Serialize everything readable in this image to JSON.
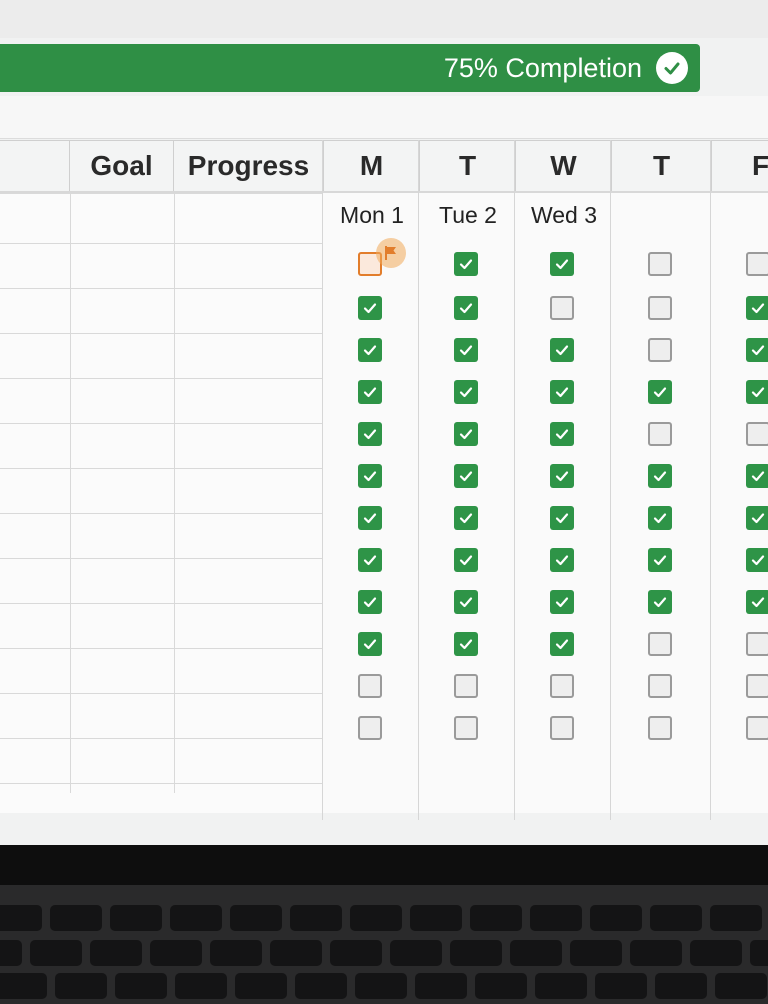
{
  "banner": {
    "completion_text": "75% Completion",
    "icon": "check-circle-icon"
  },
  "columns": {
    "goal": "Goal",
    "progress": "Progress"
  },
  "days": [
    {
      "letter": "M",
      "date": "Mon 1",
      "checks": [
        0,
        1,
        1,
        1,
        1,
        1,
        1,
        1,
        1,
        1,
        0,
        0
      ],
      "flagged_row": 0
    },
    {
      "letter": "T",
      "date": "Tue 2",
      "checks": [
        1,
        1,
        1,
        1,
        1,
        1,
        1,
        1,
        1,
        1,
        0,
        0
      ]
    },
    {
      "letter": "W",
      "date": "Wed 3",
      "checks": [
        1,
        0,
        1,
        1,
        1,
        1,
        1,
        1,
        1,
        1,
        0,
        0
      ]
    },
    {
      "letter": "T",
      "date": "",
      "checks": [
        0,
        0,
        0,
        1,
        0,
        1,
        1,
        1,
        1,
        0,
        0,
        0
      ]
    },
    {
      "letter": "F",
      "date": "",
      "checks": [
        0,
        1,
        1,
        1,
        0,
        1,
        1,
        1,
        1,
        0,
        0,
        0
      ]
    }
  ],
  "colors": {
    "accent_green": "#2f8f45",
    "check_green": "#2e9447",
    "flag_orange": "#e27d2b"
  },
  "flag_icon": "flag-icon"
}
